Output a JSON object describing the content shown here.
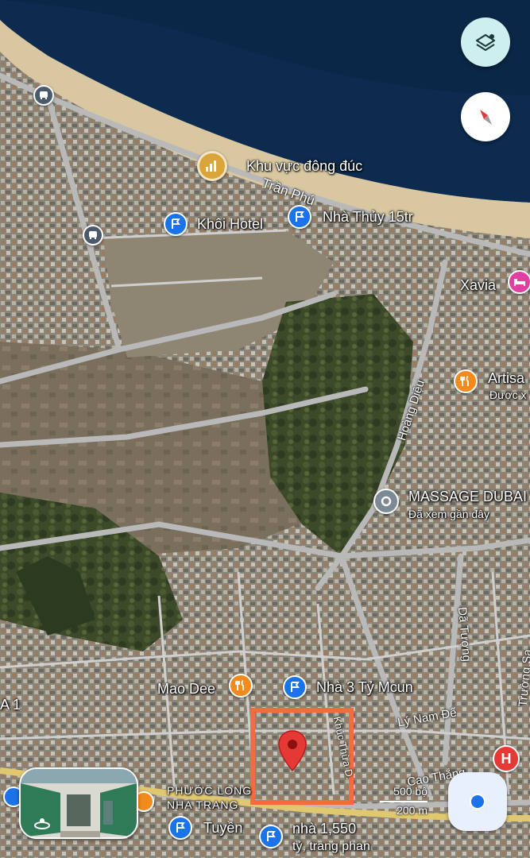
{
  "colors": {
    "sea": "#0c2b4e",
    "beach": "#d8c7a0",
    "road": "#b9b9b9",
    "pin_blue": "#1a73e8",
    "pin_orange": "#f28b1e",
    "pin_red": "#e53935",
    "hotel_pink": "#e040a0",
    "crowd_yellow": "#d9a43a",
    "highlight_box": "#f26d3d"
  },
  "places": [
    {
      "id": "crowd",
      "label": "Khu vực đông đúc",
      "icon": "crowd-icon"
    },
    {
      "id": "khoi",
      "label": "Khôi Hotel",
      "icon": "flag-icon"
    },
    {
      "id": "thuy",
      "label": "Nhà Thủy 15tr",
      "icon": "flag-icon"
    },
    {
      "id": "xavia",
      "label": "Xavia",
      "icon": "bed-icon"
    },
    {
      "id": "artisa",
      "label": "Artisa",
      "sublabel": "Được x",
      "icon": "restaurant-icon"
    },
    {
      "id": "massage",
      "label": "MASSAGE DUBAI",
      "sublabel": "Đã xem gần đây",
      "icon": "history-icon"
    },
    {
      "id": "maodee",
      "label": "Mao Dee",
      "icon": "restaurant-icon"
    },
    {
      "id": "nha3ty",
      "label": "Nhà 3 Tỷ Mcun",
      "icon": "flag-icon"
    },
    {
      "id": "tuyen",
      "label": "Tuyền",
      "icon": "flag-icon"
    },
    {
      "id": "nha1550",
      "label": "nhà 1,550",
      "sublabel": "tỷ, trang phan",
      "icon": "flag-icon"
    },
    {
      "id": "phuoclong",
      "label": "PHƯỚC LONG",
      "sublabel": "NHA TRANG",
      "icon": ""
    },
    {
      "id": "a1",
      "label": "A 1",
      "icon": ""
    }
  ],
  "roads": {
    "tranphu": "Trần Phú",
    "hoangdieu": "Hoàng Diệu",
    "datuong": "Dã Tượng",
    "truongsa": "Trường Sa",
    "lynamde": "Lý Nam Đế",
    "caothang": "Cao Thắng",
    "khucthua": "Khúc Thừa D."
  },
  "scale": {
    "label_top": "500 bộ",
    "label_bottom": "200 m"
  },
  "controls": {
    "layers": "layers-icon",
    "compass": "compass-icon",
    "location": "my-location-icon",
    "streetview": "street-view-icon",
    "hospital": "H"
  }
}
